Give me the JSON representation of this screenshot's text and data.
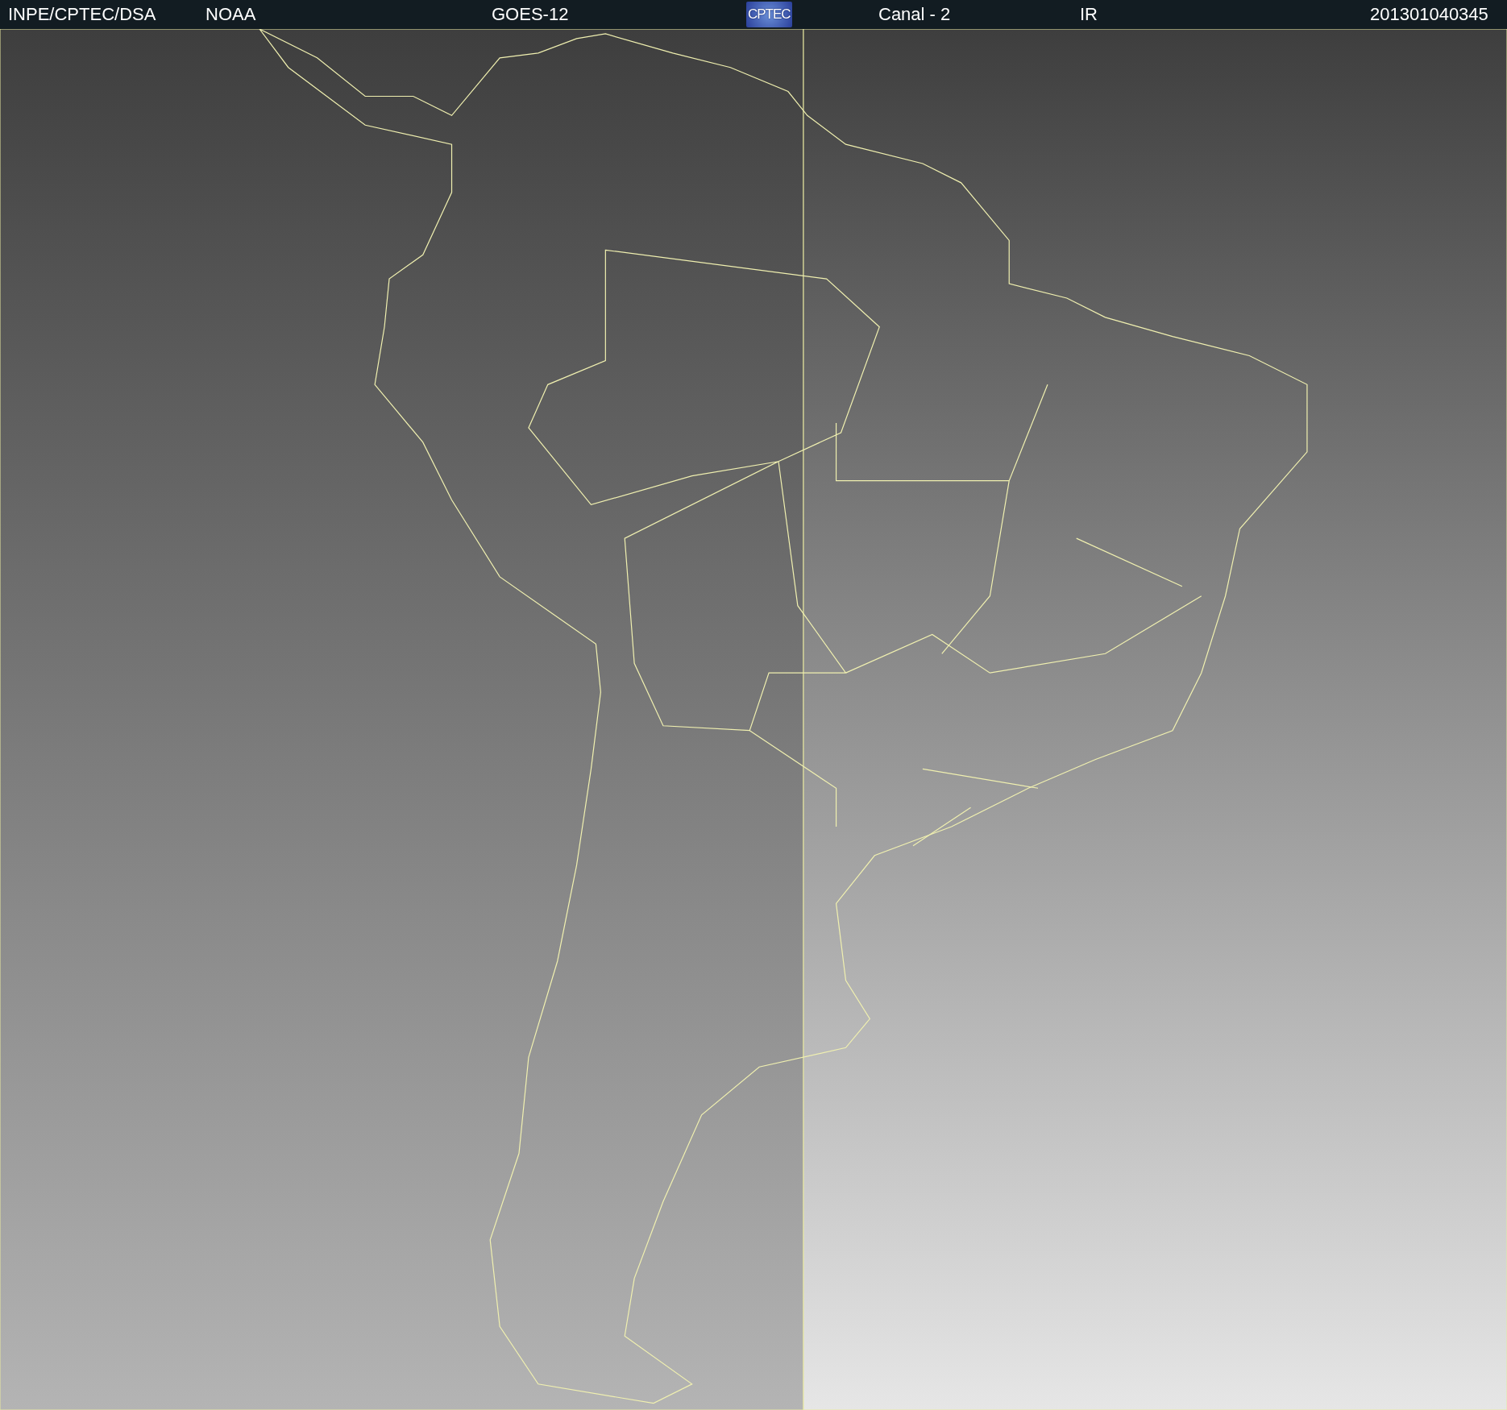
{
  "header": {
    "items": [
      {
        "kind": "text",
        "text": "INPE/CPTEC/DSA"
      },
      {
        "kind": "text",
        "text": "NOAA"
      },
      {
        "kind": "text",
        "text": "GOES-12"
      },
      {
        "kind": "logo",
        "text": "CPTEC"
      },
      {
        "kind": "text",
        "text": "Canal - 2"
      },
      {
        "kind": "text",
        "text": "IR"
      },
      {
        "kind": "text",
        "text": "201301040345"
      }
    ]
  }
}
